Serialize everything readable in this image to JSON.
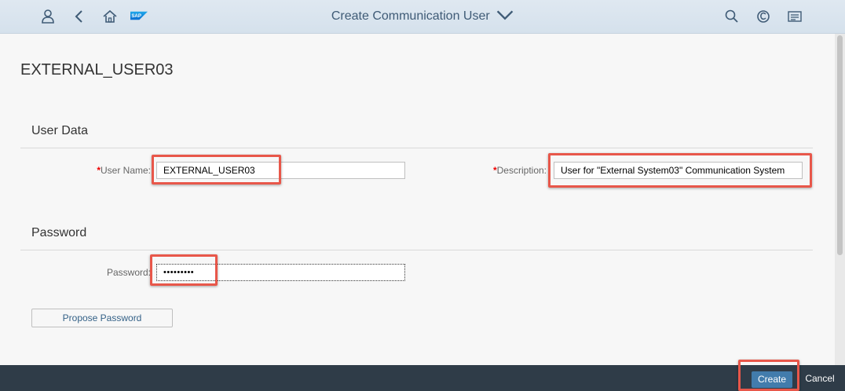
{
  "shell": {
    "title": "Create Communication User",
    "logo_text": "SAP",
    "icons": [
      "user-icon",
      "back-icon",
      "home-icon",
      "search-icon",
      "copilot-icon",
      "notifications-icon"
    ]
  },
  "object": {
    "title": "EXTERNAL_USER03"
  },
  "user_data": {
    "section_title": "User Data",
    "user_name_label": "User Name:",
    "user_name_value": "EXTERNAL_USER03",
    "description_label": "Description:",
    "description_value": "User for \"External System03\" Communication System",
    "required_marker": "*"
  },
  "password": {
    "section_title": "Password",
    "password_label": "Password:",
    "password_value": "•••••••••",
    "propose_button": "Propose Password"
  },
  "footer": {
    "create": "Create",
    "cancel": "Cancel"
  },
  "colors": {
    "shell_bg": "#d5e1ec",
    "footer_bg": "#2f3c48",
    "emphasized_button": "#427cac",
    "highlight": "#e8574a"
  }
}
